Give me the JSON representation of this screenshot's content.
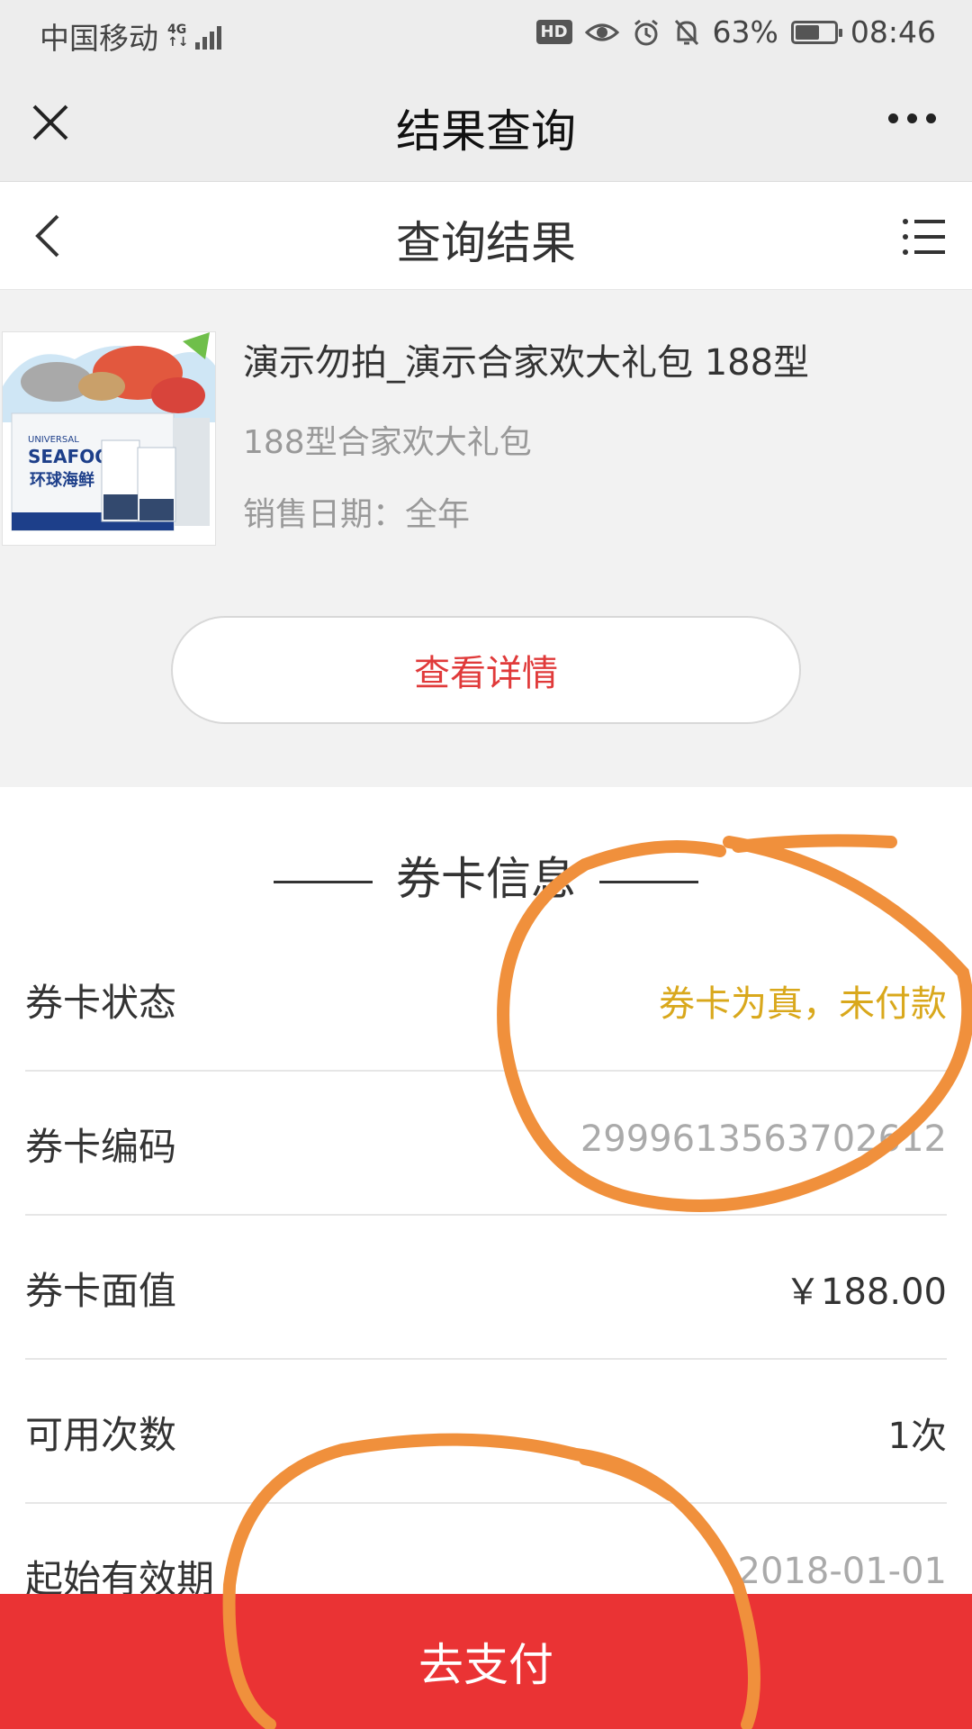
{
  "status_bar": {
    "carrier": "中国移动",
    "network": "4G",
    "battery": "63%",
    "battery_level": 0.63,
    "time": "08:46",
    "hd_badge": "HD"
  },
  "topbar": {
    "title": "结果查询"
  },
  "page_header": {
    "title": "查询结果"
  },
  "product": {
    "title": "演示勿拍_演示合家欢大礼包 188型",
    "subtitle": "188型合家欢大礼包",
    "sale_date": "销售日期：全年",
    "image_text": {
      "brand_small": "UNIVERSAL",
      "brand": "SEAFOOD",
      "brand_cn": "环球海鲜"
    },
    "detail_button": "查看详情"
  },
  "card_info": {
    "section_title": "券卡信息",
    "rows": [
      {
        "key": "券卡状态",
        "value": "券卡为真，未付款"
      },
      {
        "key": "券卡编码",
        "value": "2999613563702612"
      },
      {
        "key": "券卡面值",
        "value": "￥188.00"
      },
      {
        "key": "可用次数",
        "value": "1次"
      },
      {
        "key": "起始有效期",
        "value": "2018-01-01"
      }
    ]
  },
  "pay_button": "去支付",
  "colors": {
    "accent_red": "#ea3334",
    "status_gold": "#d9a81c",
    "annotation_orange": "#f0903c"
  }
}
